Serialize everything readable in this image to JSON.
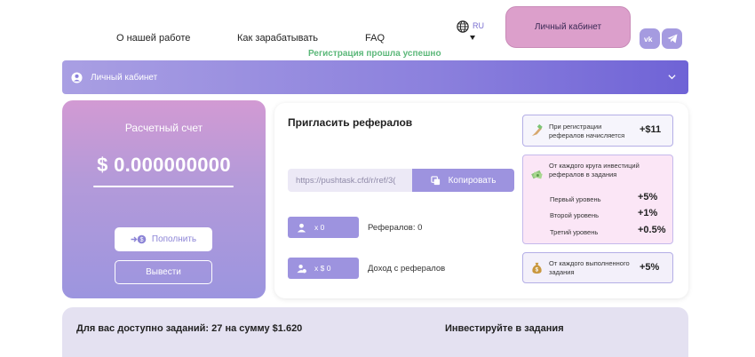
{
  "nav": {
    "items": [
      "О нашей работе",
      "Как зарабатывать",
      "FAQ"
    ],
    "language": "RU",
    "cabinet_button": "Личный кабинет",
    "social": [
      "VK",
      "Telegram"
    ]
  },
  "notice": {
    "success": "Регистрация прошла успешно"
  },
  "account_bar": {
    "label": "Личный кабинет"
  },
  "balance": {
    "title": "Расчетный счет",
    "amount": "$ 0.000000000",
    "topup_label": "Пополнить",
    "withdraw_label": "Вывести"
  },
  "referrals": {
    "title": "Пригласить рефералов",
    "link_value": "https://pushtask.cfd/r/ref/3(",
    "copy_label": "Копировать",
    "count_badge": "x 0",
    "count_label": "Рефералов: 0",
    "income_badge": "x $ 0",
    "income_label": "Доход с рефералов",
    "registration_text": "При регистрации рефералов начисляется",
    "registration_bonus": "+$11",
    "round_text": "От каждого круга инвестиций рефералов в задания",
    "levels": [
      {
        "name": "Первый уровень",
        "value": "+5%"
      },
      {
        "name": "Второй уровень",
        "value": "+1%"
      },
      {
        "name": "Третий уровень",
        "value": "+0.5%"
      }
    ],
    "task_text": "От каждого выполненного задания",
    "task_bonus": "+5%"
  },
  "bottom": {
    "tasks_available": "Для вас доступно заданий: 27 на сумму $1.620",
    "invest_title": "Инвестируйте в задания"
  },
  "colors": {
    "accent": "#9d93df",
    "cabinet_button": "#dc9fcb",
    "success": "#5cb87a",
    "bottom_panel": "#e4e1f1"
  }
}
